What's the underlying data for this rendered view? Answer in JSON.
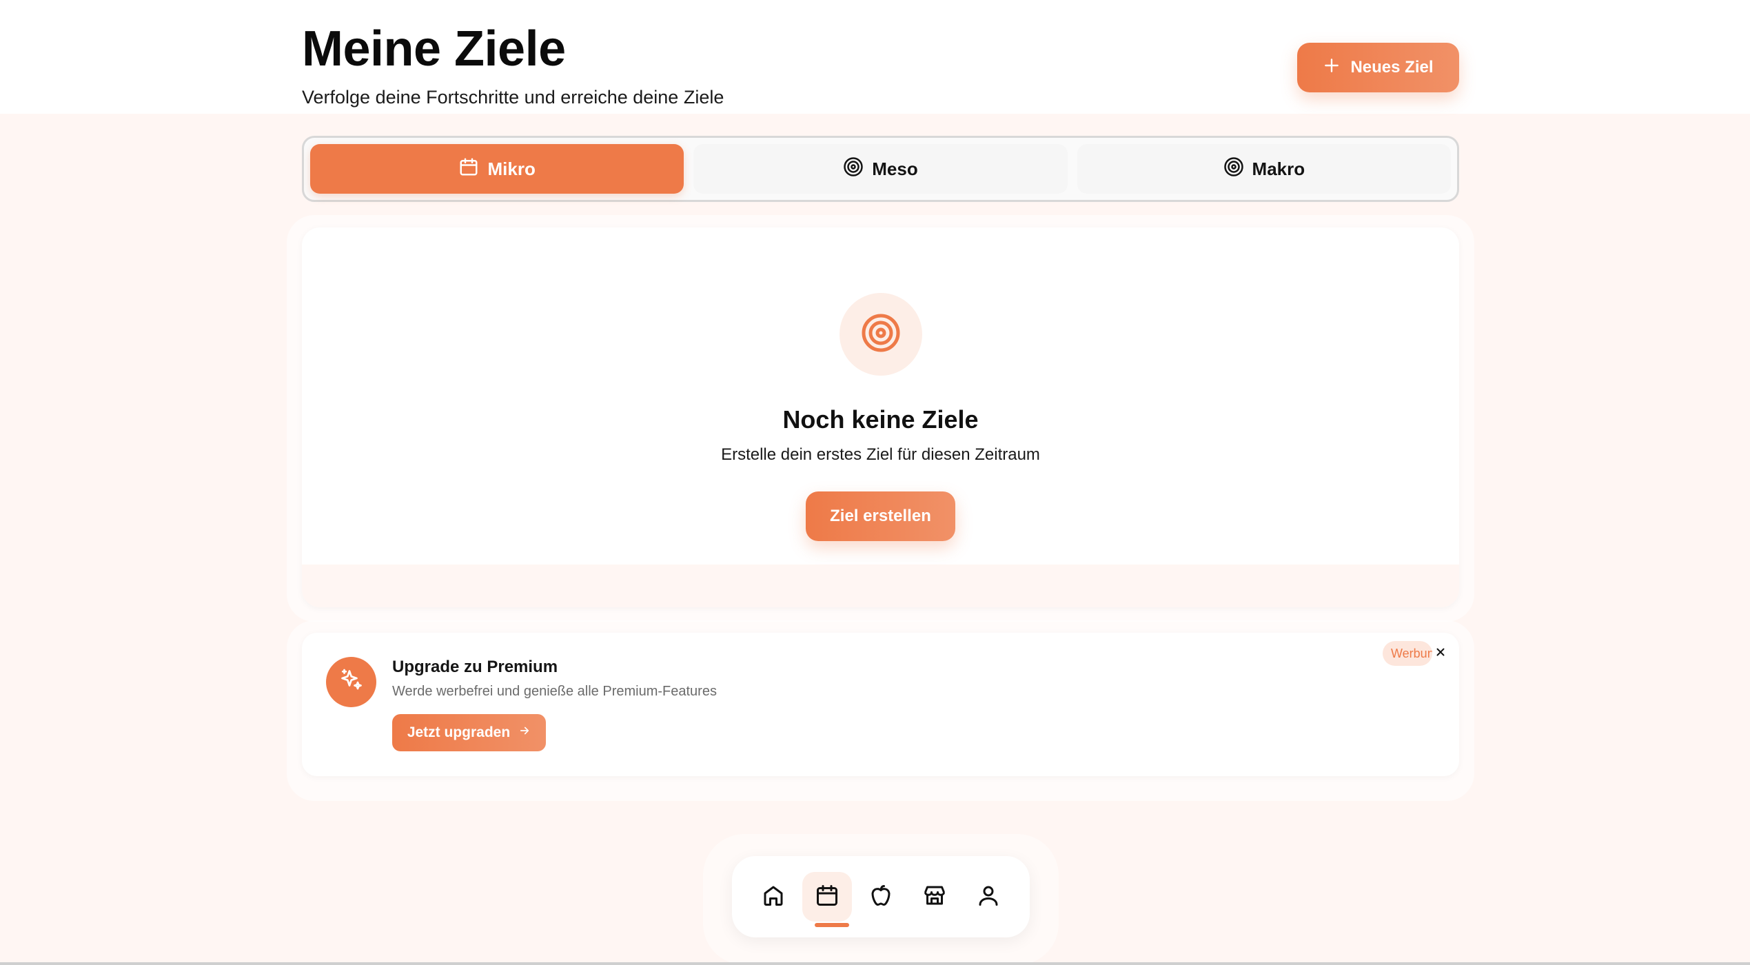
{
  "header": {
    "title": "Meine Ziele",
    "subtitle": "Verfolge deine Fortschritte und erreiche deine Ziele",
    "new_goal_label": "Neues Ziel"
  },
  "tabs": [
    {
      "label": "Mikro",
      "icon": "calendar-icon",
      "active": true
    },
    {
      "label": "Meso",
      "icon": "target-icon",
      "active": false
    },
    {
      "label": "Makro",
      "icon": "target-icon",
      "active": false
    }
  ],
  "empty_state": {
    "icon": "target-icon",
    "title": "Noch keine Ziele",
    "text": "Erstelle dein erstes Ziel für diesen Zeitraum",
    "button_label": "Ziel erstellen"
  },
  "promo": {
    "icon": "sparkles-icon",
    "title": "Upgrade zu Premium",
    "text": "Werde werbefrei und genieße alle Premium-Features",
    "button_label": "Jetzt upgraden",
    "badge": "Werbung"
  },
  "bottom_nav": [
    {
      "icon": "home-icon",
      "active": false
    },
    {
      "icon": "calendar-icon",
      "active": true
    },
    {
      "icon": "apple-icon",
      "active": false
    },
    {
      "icon": "store-icon",
      "active": false
    },
    {
      "icon": "user-icon",
      "active": false
    }
  ],
  "colors": {
    "accent": "#ee7a48",
    "accent_light": "#fdeee7",
    "background": "#fff6f3"
  }
}
